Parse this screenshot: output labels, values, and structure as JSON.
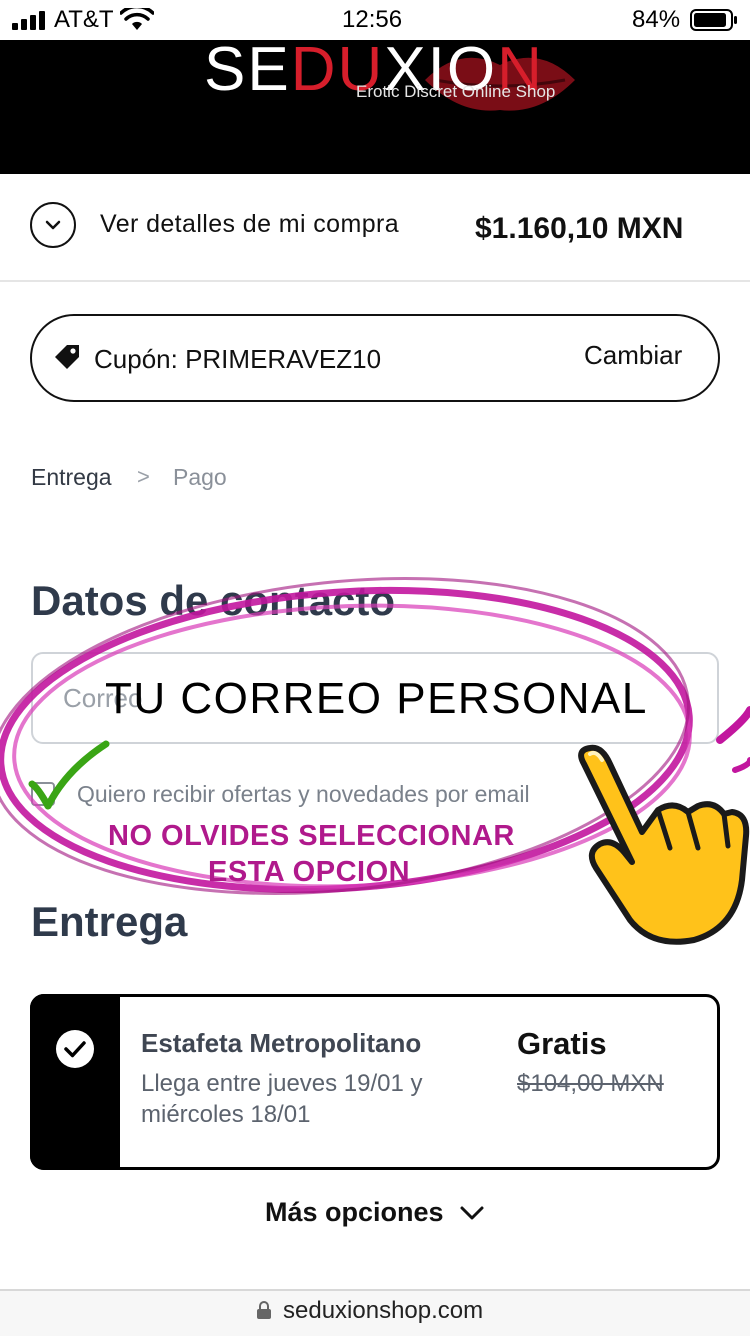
{
  "status_bar": {
    "carrier": "AT&T",
    "time": "12:56",
    "battery": "84%"
  },
  "header": {
    "logo_part1": "SE",
    "logo_part2": "DU",
    "logo_part3": "XIO",
    "logo_part4": "N",
    "tagline": "Erotic Discret Online Shop"
  },
  "summary": {
    "label": "Ver detalles de mi compra",
    "total": "$1.160,10 MXN"
  },
  "coupon": {
    "label": "Cupón: PRIMERAVEZ10",
    "change": "Cambiar"
  },
  "breadcrumb": {
    "step1": "Entrega",
    "separator": ">",
    "step2": "Pago"
  },
  "contact": {
    "heading": "Datos de contacto",
    "email_placeholder": "Correo",
    "newsletter_label": "Quiero recibir ofertas y novedades por email"
  },
  "annotations": {
    "email_hint": "TU CORREO PERSONAL",
    "note_line1": "NO OLVIDES SELECCIONAR",
    "note_line2": "ESTA OPCION",
    "ellipse_color": "#c2169e",
    "check_color": "#3aa515"
  },
  "delivery": {
    "heading": "Entrega",
    "option": {
      "name": "Estafeta Metropolitano",
      "eta_line1": "Llega entre jueves 19/01 y",
      "eta_line2": "miércoles 18/01",
      "price": "Gratis",
      "original_price": "$104,00 MXN"
    },
    "more_options": "Más opciones"
  },
  "url_bar": {
    "domain": "seduxionshop.com"
  },
  "colors": {
    "heading": "#2f3a4b",
    "brand_red": "#d61e2b",
    "magenta_note": "#b0198c"
  }
}
